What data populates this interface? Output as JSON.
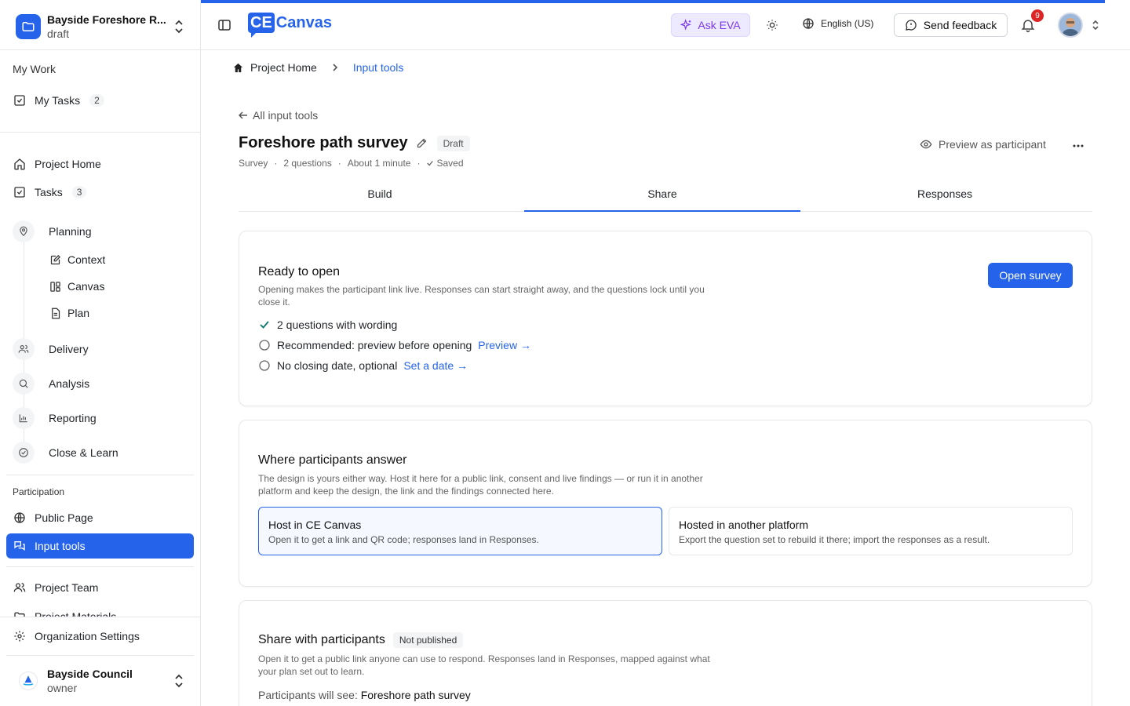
{
  "project": {
    "name": "Bayside Foreshore R...",
    "status": "draft"
  },
  "sidebar": {
    "my_work_title": "My Work",
    "my_tasks": {
      "label": "My Tasks",
      "count": "2"
    },
    "project_home": "Project Home",
    "tasks": {
      "label": "Tasks",
      "count": "3"
    },
    "stages": {
      "planning": "Planning",
      "context": "Context",
      "canvas": "Canvas",
      "plan": "Plan",
      "delivery": "Delivery",
      "analysis": "Analysis",
      "reporting": "Reporting",
      "close_learn": "Close & Learn"
    },
    "participation_title": "Participation",
    "public_page": "Public Page",
    "input_tools": "Input tools",
    "project_team": "Project Team",
    "project_materials": "Project Materials",
    "org_settings": "Organization Settings",
    "org": {
      "name": "Bayside Council",
      "role": "owner"
    }
  },
  "header": {
    "logo_ce": "CE",
    "logo_text": "Canvas",
    "ask_eva": "Ask EVA",
    "language": "English (US)",
    "send_feedback": "Send feedback",
    "notifications": "9"
  },
  "breadcrumb": {
    "home": "Project Home",
    "current": "Input tools"
  },
  "page": {
    "back_link": "All input tools",
    "title": "Foreshore path survey",
    "badge": "Draft",
    "meta": {
      "type": "Survey",
      "questions": "2 questions",
      "duration": "About 1 minute",
      "saved": "Saved"
    },
    "preview": "Preview as participant",
    "tabs": [
      "Build",
      "Share",
      "Responses"
    ],
    "active_tab": "Share"
  },
  "ready_card": {
    "title": "Ready to open",
    "description": "Opening makes the participant link live. Responses can start straight away, and the questions lock until you close it.",
    "button": "Open survey",
    "checks": [
      {
        "text": "2 questions with wording",
        "done": true,
        "link": ""
      },
      {
        "text": "Recommended: preview before opening",
        "done": false,
        "link": "Preview →"
      },
      {
        "text": "No closing date, optional",
        "done": false,
        "link": "Set a date →"
      }
    ]
  },
  "where_card": {
    "title": "Where participants answer",
    "description": "The design is yours either way. Host it here for a public link, consent and live findings — or run it in another platform and keep the design, the link and the findings connected here.",
    "options": [
      {
        "title": "Host in CE Canvas",
        "desc": "Open it to get a link and QR code; responses land in Responses.",
        "selected": true
      },
      {
        "title": "Hosted in another platform",
        "desc": "Export the question set to rebuild it there; import the responses as a result.",
        "selected": false
      }
    ]
  },
  "share_card": {
    "title": "Share with participants",
    "badge": "Not published",
    "description": "Open it to get a public link anyone can use to respond. Responses land in Responses, mapped against what your plan set out to learn.",
    "participants_prefix": "Participants will see:",
    "participants_value": "Foreshore path survey"
  },
  "colors": {
    "accent": "#2563eb",
    "eva": "#7c3aed",
    "badge_red": "#dc2626"
  }
}
